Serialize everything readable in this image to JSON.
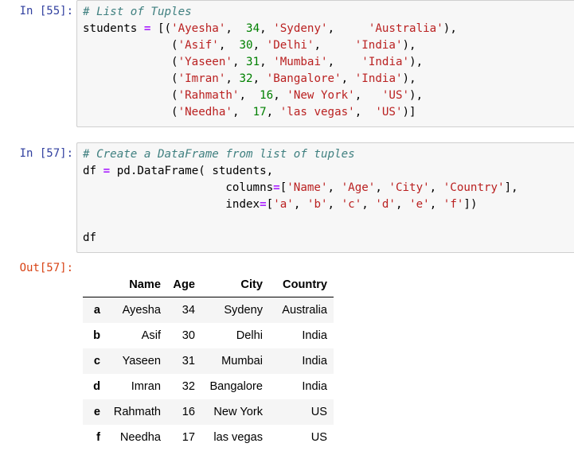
{
  "cell1": {
    "prompt": "In [55]:",
    "code": {
      "comment": "# List of Tuples",
      "var": "students",
      "rows": [
        [
          "Ayesha",
          "34",
          "Sydeny",
          "Australia"
        ],
        [
          "Asif",
          "30",
          "Delhi",
          "India"
        ],
        [
          "Yaseen",
          "31",
          "Mumbai",
          "India"
        ],
        [
          "Imran",
          "32",
          "Bangalore",
          "India"
        ],
        [
          "Rahmath",
          "16",
          "New York",
          "US"
        ],
        [
          "Needha",
          "17",
          "las vegas",
          "US"
        ]
      ]
    }
  },
  "cell2": {
    "prompt": "In [57]:",
    "code": {
      "comment": "# Create a DataFrame from list of tuples",
      "var": "df",
      "call": "pd.DataFrame",
      "arg": "students",
      "kw_columns": "columns",
      "columns": [
        "Name",
        "Age",
        "City",
        "Country"
      ],
      "kw_index": "index",
      "index": [
        "a",
        "b",
        "c",
        "d",
        "e",
        "f"
      ],
      "last_line": "df"
    }
  },
  "output": {
    "prompt": "Out[57]:",
    "table": {
      "headers": [
        "Name",
        "Age",
        "City",
        "Country"
      ],
      "rows": [
        {
          "index": "a",
          "Name": "Ayesha",
          "Age": "34",
          "City": "Sydeny",
          "Country": "Australia"
        },
        {
          "index": "b",
          "Name": "Asif",
          "Age": "30",
          "City": "Delhi",
          "Country": "India"
        },
        {
          "index": "c",
          "Name": "Yaseen",
          "Age": "31",
          "City": "Mumbai",
          "Country": "India"
        },
        {
          "index": "d",
          "Name": "Imran",
          "Age": "32",
          "City": "Bangalore",
          "Country": "India"
        },
        {
          "index": "e",
          "Name": "Rahmath",
          "Age": "16",
          "City": "New York",
          "Country": "US"
        },
        {
          "index": "f",
          "Name": "Needha",
          "Age": "17",
          "City": "las vegas",
          "Country": "US"
        }
      ]
    }
  },
  "colors": {
    "in_prompt": "#303f9f",
    "out_prompt": "#d84315",
    "comment": "#408080",
    "string": "#ba2121",
    "number": "#008000",
    "operator": "#aa22ff"
  }
}
